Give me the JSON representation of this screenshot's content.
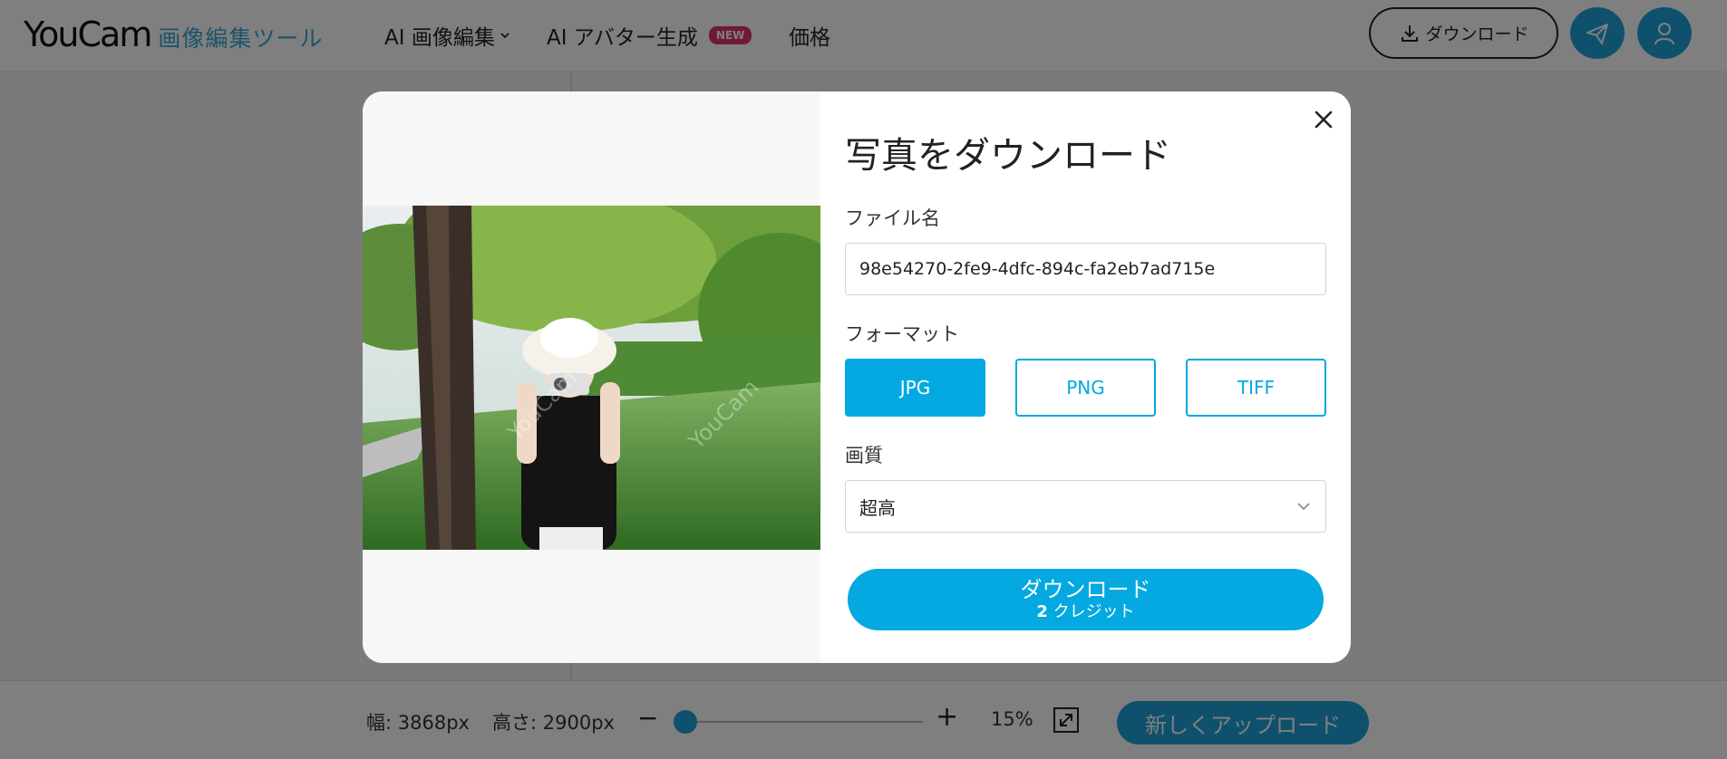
{
  "header": {
    "logo_word": "YouCam",
    "logo_sub": "画像編集ツール",
    "nav": [
      {
        "label": "AI 画像編集"
      },
      {
        "label": "AI アバター生成",
        "badge": "NEW"
      },
      {
        "label": "価格"
      }
    ],
    "download_label": "ダウンロード"
  },
  "bottom_bar": {
    "width_text": "幅: 3868px",
    "height_text": "高さ: 2900px",
    "minus": "−",
    "plus": "+",
    "zoom_level": "15%",
    "upload_label": "新しくアップロード"
  },
  "modal": {
    "title": "写真をダウンロード",
    "file_label": "ファイル名",
    "file_value": "98e54270-2fe9-4dfc-894c-fa2eb7ad715e",
    "format_label": "フォーマット",
    "formats": [
      "JPG",
      "PNG",
      "TIFF"
    ],
    "selected_format": "JPG",
    "quality_label": "画質",
    "quality_value": "超高",
    "download_label": "ダウンロード",
    "credit_count": "2",
    "credit_label": "クレジット",
    "watermark_text": "YouCam"
  },
  "colors": {
    "accent": "#03a9e0",
    "brand_blue": "#1fa3d9",
    "new_badge": "#e0336b",
    "overlay": "rgba(0,0,0,0.5)"
  },
  "icons": [
    "chevron-down-icon",
    "download-icon",
    "send-icon",
    "user-icon",
    "close-icon",
    "fit-screen-icon"
  ]
}
